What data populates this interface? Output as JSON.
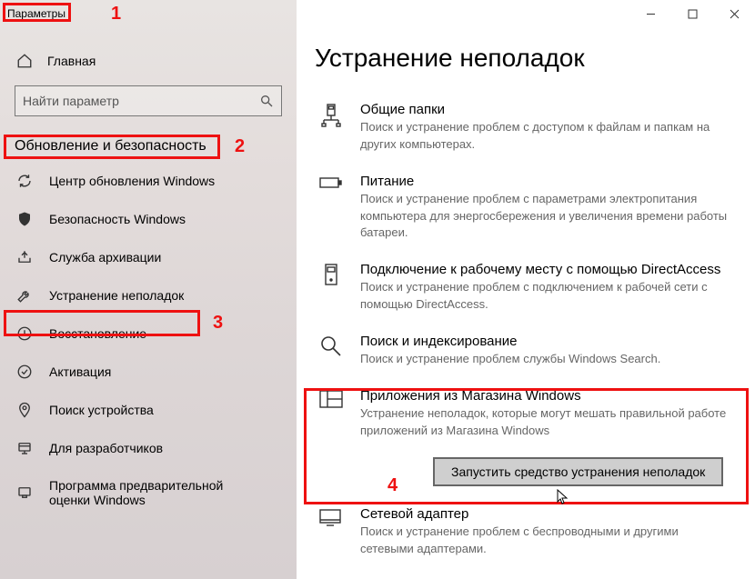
{
  "window": {
    "title": "Параметры"
  },
  "sidebar": {
    "home_label": "Главная",
    "search_placeholder": "Найти параметр",
    "section_header": "Обновление и безопасность",
    "items": [
      {
        "label": "Центр обновления Windows",
        "icon": "sync-icon"
      },
      {
        "label": "Безопасность Windows",
        "icon": "shield-icon"
      },
      {
        "label": "Служба архивации",
        "icon": "backup-icon"
      },
      {
        "label": "Устранение неполадок",
        "icon": "wrench-icon",
        "selected": true
      },
      {
        "label": "Восстановление",
        "icon": "recovery-icon"
      },
      {
        "label": "Активация",
        "icon": "activation-icon"
      },
      {
        "label": "Поиск устройства",
        "icon": "find-device-icon"
      },
      {
        "label": "Для разработчиков",
        "icon": "developer-icon"
      },
      {
        "label": "Программа предварительной оценки Windows",
        "icon": "insider-icon"
      }
    ]
  },
  "main": {
    "page_title": "Устранение неполадок",
    "items": [
      {
        "icon": "shared-folders-icon",
        "title": "Общие папки",
        "desc": "Поиск и устранение проблем с доступом к файлам и папкам на других компьютерах."
      },
      {
        "icon": "power-icon",
        "title": "Питание",
        "desc": "Поиск и устранение проблем с параметрами электропитания компьютера для энергосбережения и увеличения  времени работы батареи."
      },
      {
        "icon": "directaccess-icon",
        "title": "Подключение к рабочему месту с помощью DirectAccess",
        "desc": "Поиск и устранение проблем с подключением к рабочей сети с помощью DirectAccess."
      },
      {
        "icon": "search-index-icon",
        "title": "Поиск и индексирование",
        "desc": "Поиск и устранение проблем службы Windows Search."
      },
      {
        "icon": "store-apps-icon",
        "title": "Приложения из Магазина Windows",
        "desc": "Устранение неполадок, которые могут мешать правильной работе приложений из Магазина Windows",
        "selected": true,
        "button_label": "Запустить средство устранения неполадок"
      },
      {
        "icon": "network-adapter-icon",
        "title": "Сетевой адаптер",
        "desc": "Поиск и устранение проблем с беспроводными и другими сетевыми адаптерами."
      }
    ]
  },
  "annotations": {
    "n1": "1",
    "n2": "2",
    "n3": "3",
    "n4": "4"
  }
}
